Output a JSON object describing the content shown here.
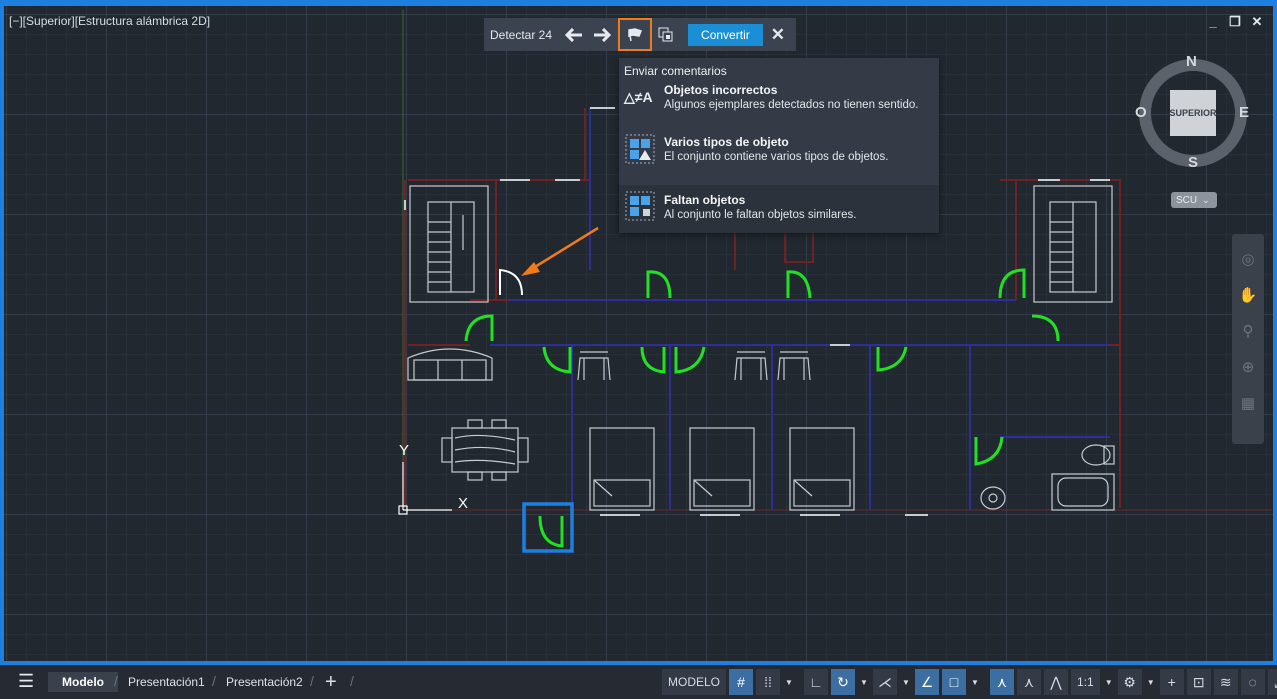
{
  "viewport": {
    "label": "[−][Superior][Estructura alámbrica 2D]",
    "controls": [
      "_",
      "❐",
      "✕"
    ]
  },
  "detect_toolbar": {
    "label": "Detectar 24",
    "prev_icon": "arrow-left-icon",
    "next_icon": "arrow-right-icon",
    "feedback_icon": "flag-icon",
    "select_icon": "select-set-icon",
    "convert_label": "Convertir",
    "close_icon": "close-icon"
  },
  "feedback_panel": {
    "title": "Enviar comentarios",
    "items": [
      {
        "icon": "incorrect-objects-icon",
        "icon_text": "△≠A",
        "title": "Objetos incorrectos",
        "desc": "Algunos ejemplares detectados no tienen sentido."
      },
      {
        "icon": "multiple-types-icon",
        "title": "Varios tipos de objeto",
        "desc": "El conjunto contiene varios tipos de objetos."
      },
      {
        "icon": "missing-objects-icon",
        "title": "Faltan objetos",
        "desc": "Al conjunto le faltan objetos similares."
      }
    ]
  },
  "viewcube": {
    "north": "N",
    "south": "S",
    "east": "E",
    "west": "O",
    "face": "SUPERIOR",
    "ucs_label": "SCU"
  },
  "ucs_icon": {
    "y_label": "Y",
    "x_label": "X"
  },
  "statusbar": {
    "tabs": [
      "Modelo",
      "Presentación1",
      "Presentación2"
    ],
    "add_tab": "+",
    "model_button": "MODELO",
    "scale": "1:1"
  },
  "colors": {
    "accent": "#1d7fe0",
    "highlight_orange": "#f07b1a",
    "detected_green": "#22e022",
    "wall_blue": "#2c2f9a",
    "wall_red": "#6e2226",
    "furniture": "#c8ccd2"
  }
}
